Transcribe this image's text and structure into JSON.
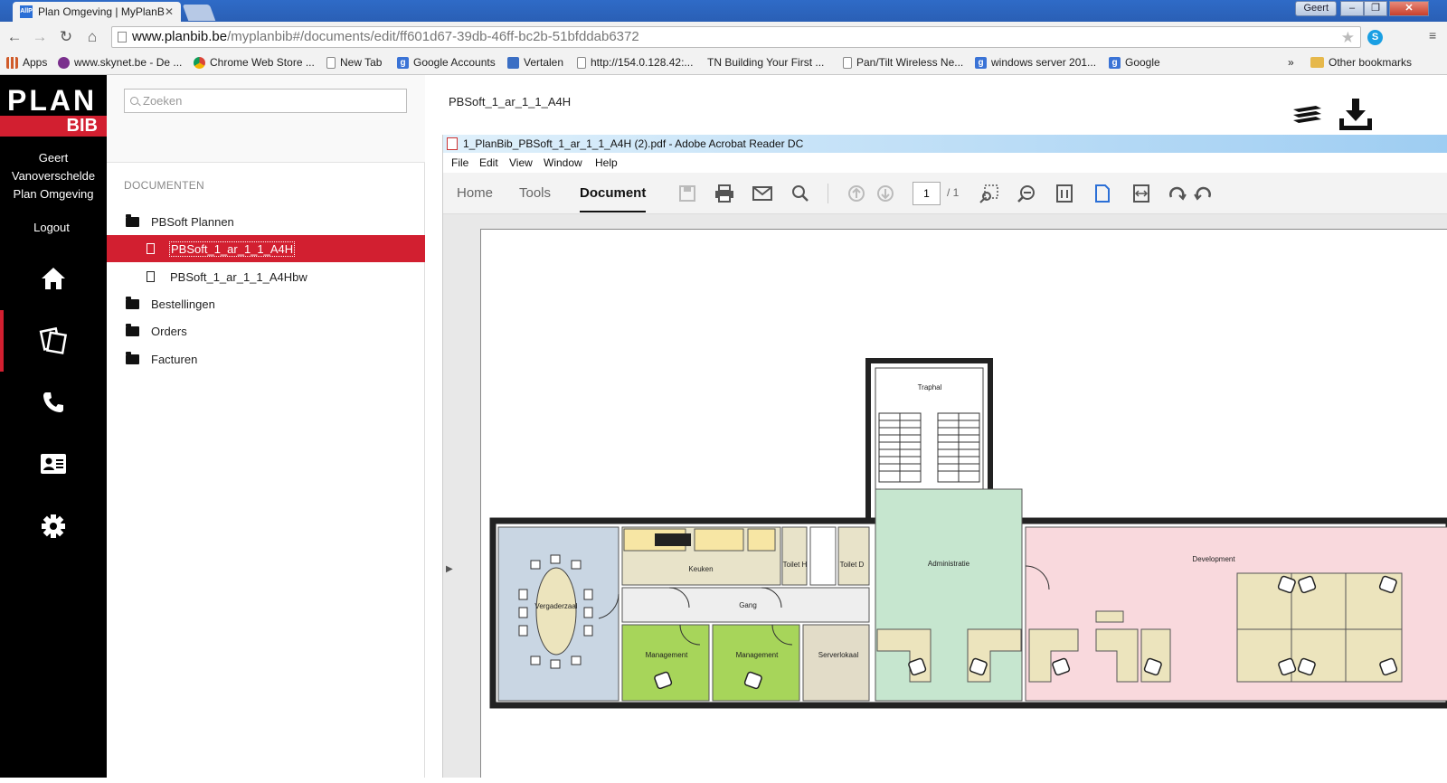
{
  "browser": {
    "tab_title": "Plan Omgeving | MyPlanB",
    "tab_favicon": "AllP",
    "user_badge": "Geert",
    "url_host": "www.planbib.be",
    "url_path": "/myplanbib#/documents/edit/ff601d67-39db-46ff-bc2b-51bfddab6372",
    "bookmarks": [
      {
        "label": "Apps",
        "icon": "grid"
      },
      {
        "label": "www.skynet.be - De ...",
        "icon": "sky"
      },
      {
        "label": "Chrome Web Store ...",
        "icon": "chrome"
      },
      {
        "label": "New Tab",
        "icon": "page"
      },
      {
        "label": "Google Accounts",
        "icon": "g"
      },
      {
        "label": "Vertalen",
        "icon": "trans"
      },
      {
        "label": "http://154.0.128.42:...",
        "icon": "page"
      },
      {
        "label": "TN Building Your First ...",
        "icon": "none"
      },
      {
        "label": "Pan/Tilt Wireless Ne...",
        "icon": "page"
      },
      {
        "label": "windows server 201...",
        "icon": "g"
      },
      {
        "label": "Google",
        "icon": "g"
      }
    ],
    "bookmarks_overflow": "»",
    "other_bookmarks": "Other bookmarks"
  },
  "sidebar": {
    "logo_word": "PLAN",
    "logo_sub": "BIB",
    "user_line1": "Geert",
    "user_line2": "Vanoverschelde",
    "user_line3": "Plan Omgeving",
    "logout": "Logout",
    "nav_icons": [
      "home-icon",
      "documents-icon",
      "phone-icon",
      "contact-card-icon",
      "settings-icon"
    ]
  },
  "panel": {
    "search_placeholder": "Zoeken",
    "section_title": "DOCUMENTEN",
    "folders": [
      {
        "label": "PBSoft Plannen"
      },
      {
        "label": "Bestellingen"
      },
      {
        "label": "Orders"
      },
      {
        "label": "Facturen"
      }
    ],
    "files": [
      {
        "label": "PBSoft_1_ar_1_1_A4H",
        "selected": true
      },
      {
        "label": "PBSoft_1_ar_1_1_A4Hbw",
        "selected": false
      }
    ]
  },
  "viewer": {
    "doc_title": "PBSoft_1_ar_1_1_A4H",
    "acrobat_title": "1_PlanBib_PBSoft_1_ar_1_1_A4H (2).pdf - Adobe Acrobat Reader DC",
    "menu": [
      "File",
      "Edit",
      "View",
      "Window",
      "Help"
    ],
    "tabs": [
      "Home",
      "Tools",
      "Document"
    ],
    "active_tab": "Document",
    "page_current": "1",
    "page_total": "/ 1",
    "collapse_arrow": "▶"
  },
  "floorplan": {
    "rooms": [
      "Traphal",
      "Vergaderzaal",
      "Keuken",
      "Toilet H",
      "Toilet D",
      "Administratie",
      "Development",
      "Gang",
      "Management",
      "Management",
      "Serverlokaal"
    ]
  },
  "colors": {
    "brand_red": "#d21f30",
    "room_meeting": "#c9d6e3",
    "room_admin": "#c6e6cf",
    "room_dev": "#f9d9dd",
    "room_mgmt": "#a7d55a",
    "room_kitchen": "#e8e3c9"
  }
}
